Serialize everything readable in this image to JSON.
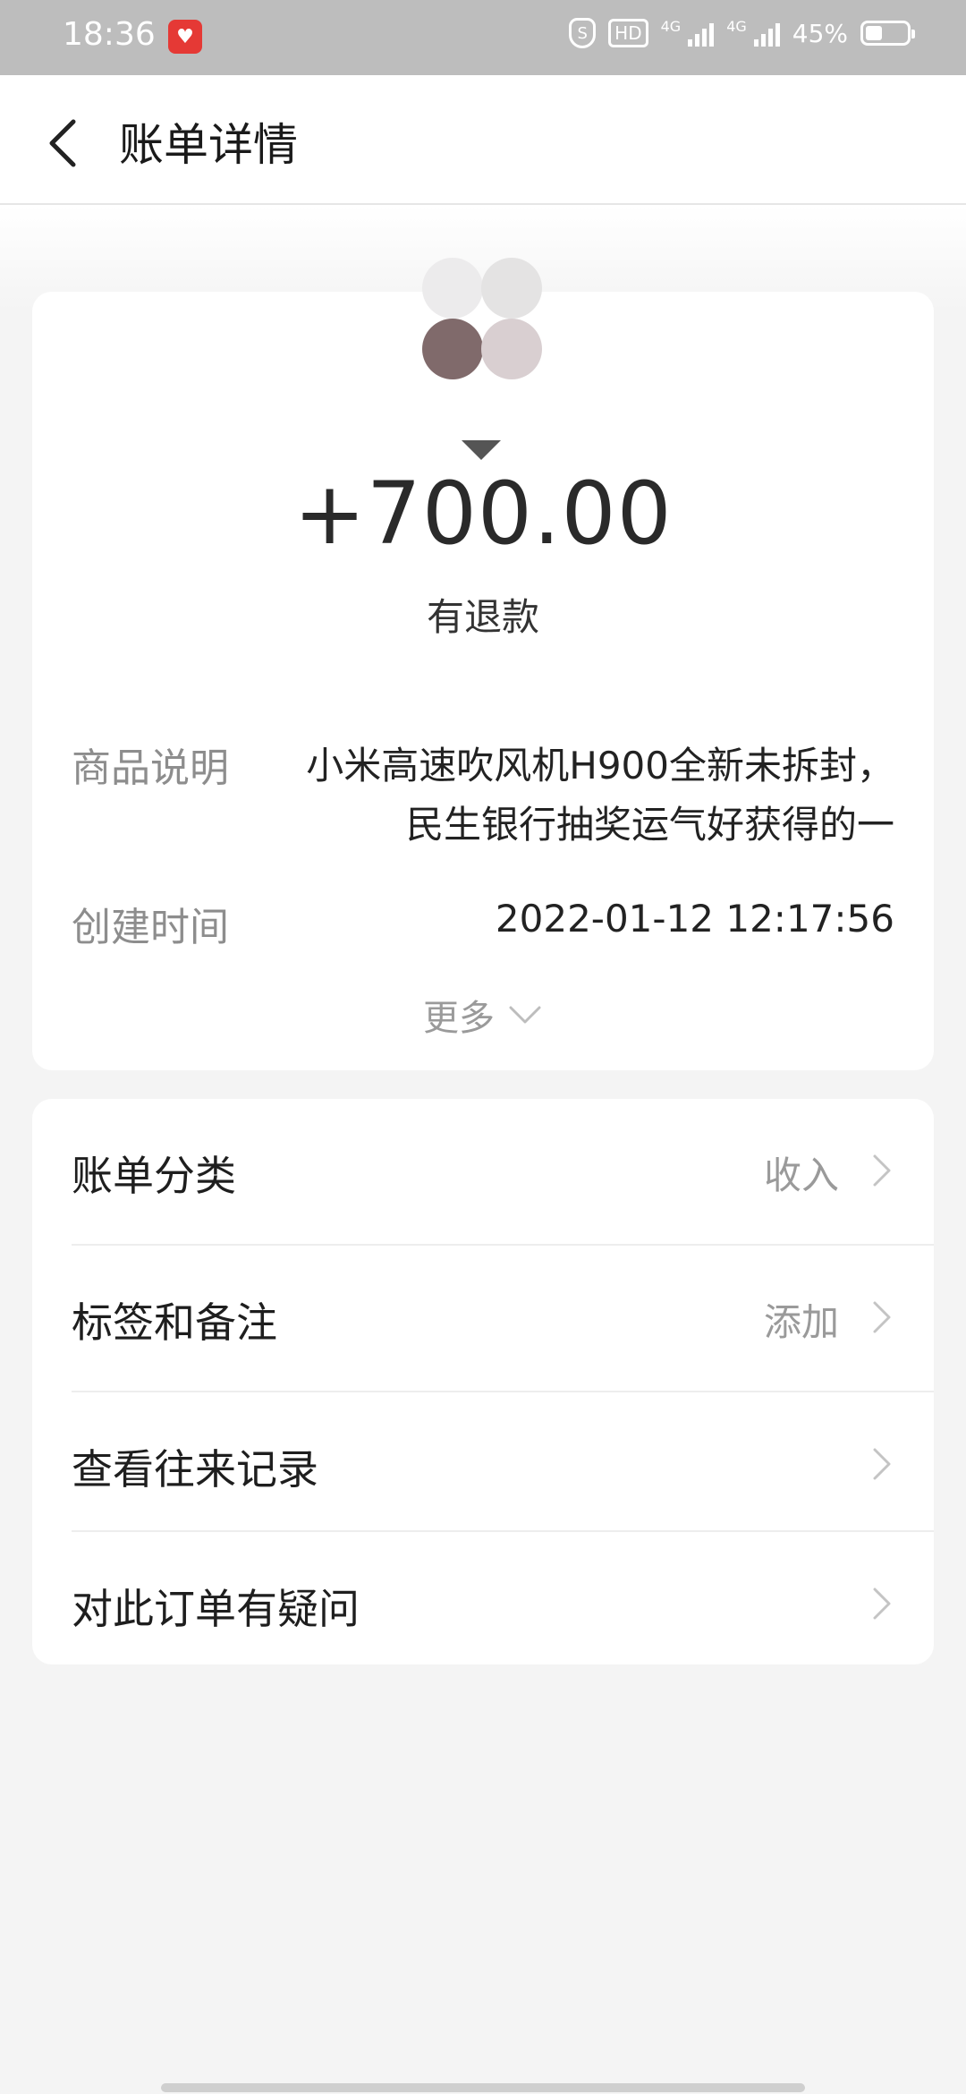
{
  "status_bar": {
    "time": "18:36",
    "app_icon": "heart-app-icon",
    "hd": "HD",
    "net1": "4G",
    "net2": "4G",
    "battery": "45%"
  },
  "header": {
    "title": "账单详情",
    "back_icon": "chevron-left-icon"
  },
  "bill": {
    "amount": "+700.00",
    "status": "有退款",
    "desc_label": "商品说明",
    "desc_line1": "小米高速吹风机H900全新未拆封，",
    "desc_line2": "民生银行抽奖运气好获得的一",
    "time_label": "创建时间",
    "time_value": "2022-01-12 12:17:56",
    "more_label": "更多"
  },
  "menu": [
    {
      "label": "账单分类",
      "value": "收入"
    },
    {
      "label": "标签和备注",
      "value": "添加"
    },
    {
      "label": "查看往来记录",
      "value": ""
    },
    {
      "label": "对此订单有疑问",
      "value": ""
    }
  ],
  "colors": {
    "status_bar": "#bdbdbd",
    "background": "#f4f4f4",
    "card": "#ffffff",
    "secondary_text": "#9a9a9a"
  }
}
